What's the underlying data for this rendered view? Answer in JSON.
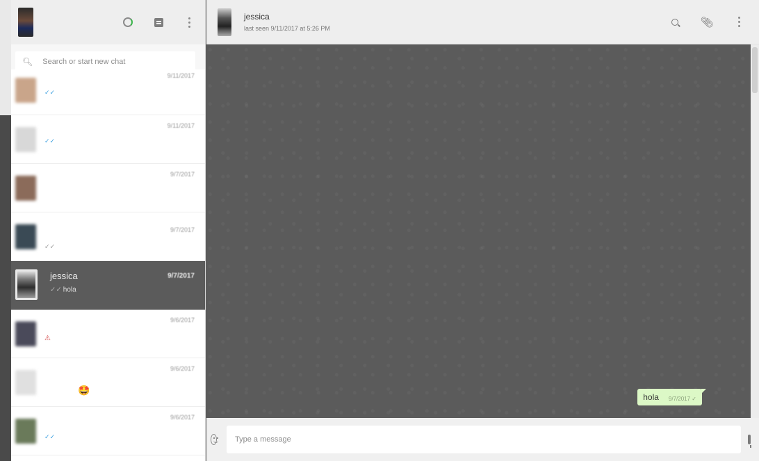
{
  "sidebar": {
    "search_placeholder": "Search or start new chat",
    "icons": [
      "status-icon",
      "new-chat-icon",
      "menu-icon"
    ],
    "chats": [
      {
        "date": "9/11/2017",
        "tick": "✓✓",
        "tick_style": "blue"
      },
      {
        "date": "9/11/2017",
        "tick": "✓✓",
        "tick_style": "blue"
      },
      {
        "date": "9/7/2017",
        "tick": "",
        "tick_style": "none"
      },
      {
        "date": "9/7/2017",
        "tick": "✓✓",
        "tick_style": "gray"
      },
      {
        "name": "jessica",
        "date": "9/7/2017",
        "preview_tick": "✓✓",
        "preview": "hola",
        "active": true
      },
      {
        "date": "9/6/2017",
        "tick": "⚠",
        "tick_style": "red"
      },
      {
        "date": "9/6/2017",
        "emoji": "🤩"
      },
      {
        "date": "9/6/2017",
        "tick": "✓✓",
        "tick_style": "blue"
      }
    ]
  },
  "chat": {
    "peer_name": "jessica",
    "peer_status": "last seen 9/11/2017 at 5:26 PM",
    "messages": [
      {
        "text": "hola",
        "time": "9/7/2017 ✓"
      }
    ],
    "input_placeholder": "Type a message"
  },
  "colors": {
    "outgoing_bubble": "#dcf8c6",
    "active_chat_bg": "#5b5b5b",
    "tick_blue": "#3ca0e0"
  }
}
